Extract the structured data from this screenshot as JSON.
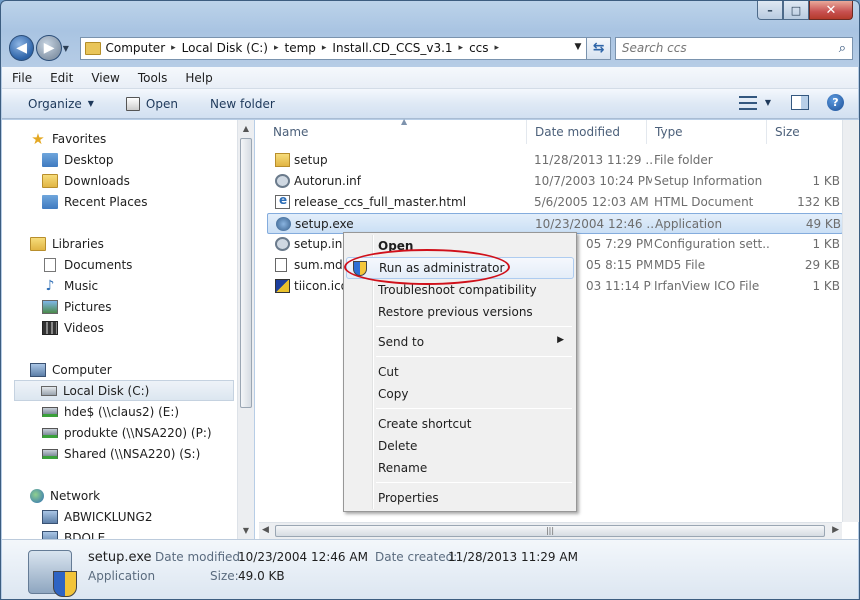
{
  "window": {
    "caption_minimize": "–",
    "caption_maximize": "□",
    "caption_close": "✕"
  },
  "address": {
    "crumbs": [
      "Computer",
      "Local Disk (C:)",
      "temp",
      "Install.CD_CCS_v3.1",
      "ccs"
    ],
    "separator": "▸",
    "search_placeholder": "Search ccs"
  },
  "menu": [
    "File",
    "Edit",
    "View",
    "Tools",
    "Help"
  ],
  "toolbar": {
    "organize": "Organize",
    "open": "Open",
    "new_folder": "New folder"
  },
  "navpane": {
    "favorites": "Favorites",
    "favorites_items": [
      "Desktop",
      "Downloads",
      "Recent Places"
    ],
    "libraries": "Libraries",
    "libraries_items": [
      "Documents",
      "Music",
      "Pictures",
      "Videos"
    ],
    "computer": "Computer",
    "computer_items": [
      "Local Disk (C:)",
      "hde$ (\\\\claus2) (E:)",
      "produkte (\\\\NSA220) (P:)",
      "Shared (\\\\NSA220) (S:)"
    ],
    "network": "Network",
    "network_items": [
      "ABWICKLUNG2",
      "BDOLE"
    ]
  },
  "columns": [
    "Name",
    "Date modified",
    "Type",
    "Size"
  ],
  "files": [
    {
      "name": "setup",
      "date": "11/28/2013 11:29 ...",
      "type": "File folder",
      "size": ""
    },
    {
      "name": "Autorun.inf",
      "date": "10/7/2003 10:24 PM",
      "type": "Setup Information",
      "size": "1 KB"
    },
    {
      "name": "release_ccs_full_master.html",
      "date": "5/6/2005 12:03 AM",
      "type": "HTML Document",
      "size": "132 KB"
    },
    {
      "name": "setup.exe",
      "date": "10/23/2004 12:46 ...",
      "type": "Application",
      "size": "49 KB"
    },
    {
      "name": "setup.ini",
      "date": "05 7:29 PM",
      "type": "Configuration sett...",
      "size": "1 KB"
    },
    {
      "name": "sum.md5",
      "date": "05 8:15 PM",
      "type": "MD5 File",
      "size": "29 KB"
    },
    {
      "name": "tiicon.ico",
      "date": "03 11:14 PM",
      "type": "IrfanView ICO File",
      "size": "1 KB"
    }
  ],
  "context_menu": {
    "open": "Open",
    "run_as_admin": "Run as administrator",
    "troubleshoot": "Troubleshoot compatibility",
    "restore": "Restore previous versions",
    "send_to": "Send to",
    "cut": "Cut",
    "copy": "Copy",
    "create_shortcut": "Create shortcut",
    "delete": "Delete",
    "rename": "Rename",
    "properties": "Properties"
  },
  "details": {
    "name": "setup.exe",
    "type": "Application",
    "date_modified_label": "Date modified:",
    "date_modified": "10/23/2004 12:46 AM",
    "date_created_label": "Date created:",
    "date_created": "11/28/2013 11:29 AM",
    "size_label": "Size:",
    "size": "49.0 KB"
  }
}
